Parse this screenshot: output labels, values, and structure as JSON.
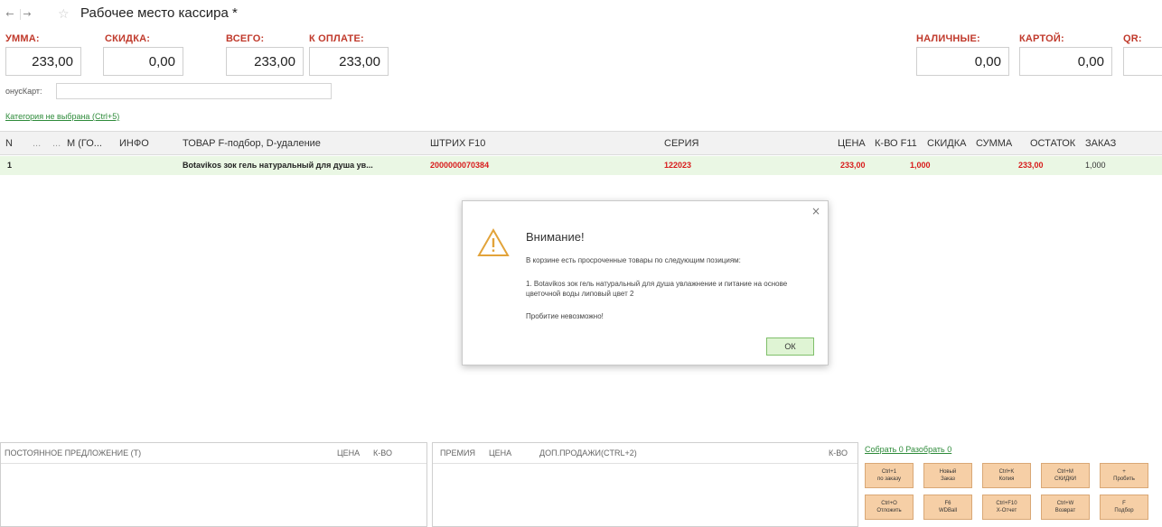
{
  "window": {
    "title": "Рабочее место кассира *"
  },
  "totals": {
    "summa": {
      "label": "УММА:",
      "value": "233,00"
    },
    "skidka": {
      "label": "СКИДКА:",
      "value": "0,00"
    },
    "vsego": {
      "label": "ВСЕГО:",
      "value": "233,00"
    },
    "k_oplate": {
      "label": "К ОПЛАТЕ:",
      "value": "233,00"
    },
    "nalichnye": {
      "label": "НАЛИЧНЫЕ:",
      "value": "0,00"
    },
    "kartoi": {
      "label": "КАРТОЙ:",
      "value": "0,00"
    },
    "qr": {
      "label": "QR:",
      "value": ""
    }
  },
  "bonus_card": {
    "label": "онусКарт:",
    "value": ""
  },
  "category_link": "Категория не выбрана (Ctrl+5)",
  "table": {
    "headers": [
      "N",
      "...",
      "...",
      "М (ГО...",
      "ИНФО",
      "ТОВАР F-подбор, D-удаление",
      "ШТРИХ F10",
      "СЕРИЯ",
      "ЦЕНА",
      "К-ВО F11",
      "СКИДКА",
      "СУММА",
      "ОСТАТОК",
      "ЗАКАЗ"
    ],
    "rows": [
      {
        "n": "1",
        "product": "Botavikos зок гель натуральный для душа ув...",
        "barcode": "2000000070384",
        "series": "122023",
        "price": "233,00",
        "qty": "1,000",
        "discount": "",
        "sum": "233,00",
        "stock": "1,000",
        "order": ""
      }
    ]
  },
  "dialog": {
    "title": "Внимание!",
    "line1": "В корзине есть просроченные товары по следующим позициям:",
    "line2": "1. Botavikos зок гель натуральный для душа увлажнение и питание на основе цветочной воды липовый цвет 2",
    "line3": "Пробитие невозможно!",
    "ok_label": "ОК",
    "close_glyph": "×"
  },
  "panels": {
    "left": {
      "title": "ПОСТОЯННОЕ ПРЕДЛОЖЕНИЕ (Т)",
      "price": "ЦЕНА",
      "qty": "К-ВО"
    },
    "middle": {
      "premia": "ПРЕМИЯ",
      "price": "ЦЕНА",
      "dop": "ДОП.ПРОДАЖИ(CTRL+2)",
      "qty": "К-ВО"
    },
    "links": "Собрать 0  Разобрать 0"
  },
  "function_buttons": [
    {
      "line1": "Ctrl+1",
      "line2": "по заказу"
    },
    {
      "line1": "Новый",
      "line2": "Заказ"
    },
    {
      "line1": "Ctrl+K",
      "line2": "Копия"
    },
    {
      "line1": "Ctrl+M",
      "line2": "СКИДКИ"
    },
    {
      "line1": "+",
      "line2": "Пробить"
    },
    {
      "line1": "Ctrl+O",
      "line2": "Отложить"
    },
    {
      "line1": "F6",
      "line2": "WDBall"
    },
    {
      "line1": "Ctrl+F10",
      "line2": "X-Отчет"
    },
    {
      "line1": "Ctrl+W",
      "line2": "Возврат"
    },
    {
      "line1": "F",
      "line2": "Подбор"
    }
  ],
  "colors": {
    "accent_red": "#c0392b",
    "row_green": "#eaf7e4",
    "button_orange": "#f6cfa6"
  }
}
